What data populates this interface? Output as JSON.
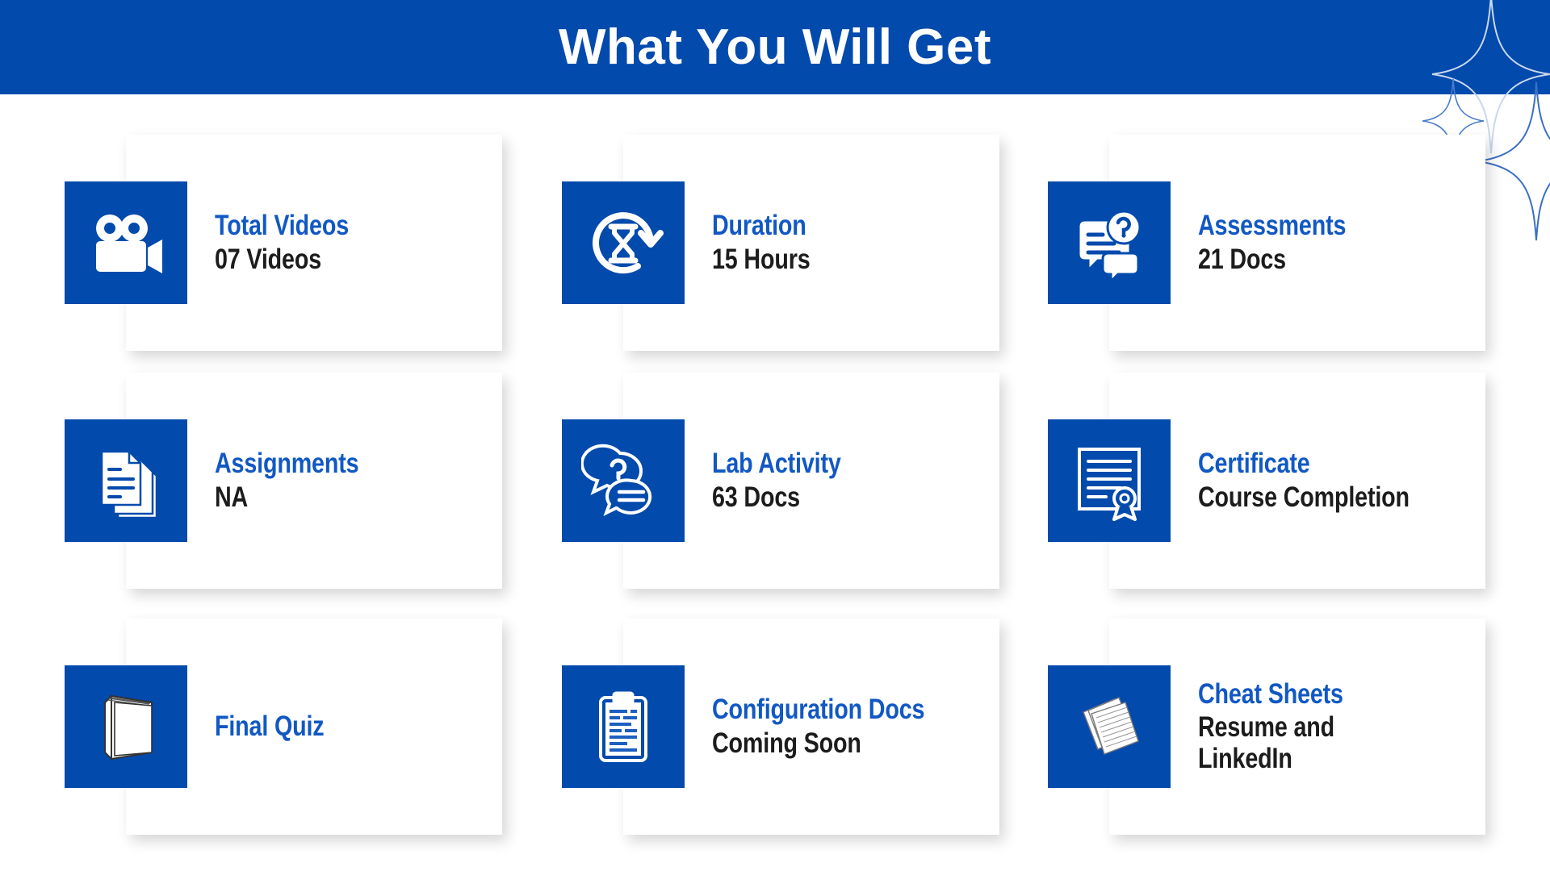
{
  "header": {
    "title": "What You Will Get",
    "background_color": "#034aad",
    "text_color": "#ffffff"
  },
  "theme": {
    "brand_blue": "#034aad",
    "title_blue": "#1158c4",
    "subtitle_dark": "#1c1c1c",
    "card_background": "#ffffff",
    "page_background": "#ffffff"
  },
  "decorations": [
    {
      "name": "sparkle-large-top",
      "color": "#3a6fc4"
    },
    {
      "name": "sparkle-small",
      "color": "#3a6fc4"
    },
    {
      "name": "sparkle-large-bottom",
      "color": "#3a6fc4"
    }
  ],
  "cards": [
    {
      "icon": "video-camera-icon",
      "title": "Total Videos",
      "subtitle": "07 Videos"
    },
    {
      "icon": "hourglass-clock-icon",
      "title": "Duration",
      "subtitle": "15 Hours"
    },
    {
      "icon": "document-question-icon",
      "title": "Assessments",
      "subtitle": "21 Docs"
    },
    {
      "icon": "stacked-documents-icon",
      "title": "Assignments",
      "subtitle": "NA"
    },
    {
      "icon": "chat-bubbles-question-icon",
      "title": "Lab Activity",
      "subtitle": "63 Docs"
    },
    {
      "icon": "certificate-ribbon-icon",
      "title": "Certificate",
      "subtitle": "Course Completion"
    },
    {
      "icon": "book-icon",
      "title": "Final Quiz",
      "subtitle": ""
    },
    {
      "icon": "clipboard-icon",
      "title": "Configuration Docs",
      "subtitle": "Coming Soon"
    },
    {
      "icon": "paper-sheets-icon",
      "title": "Cheat Sheets",
      "subtitle": "Resume and\nLinkedIn"
    }
  ]
}
